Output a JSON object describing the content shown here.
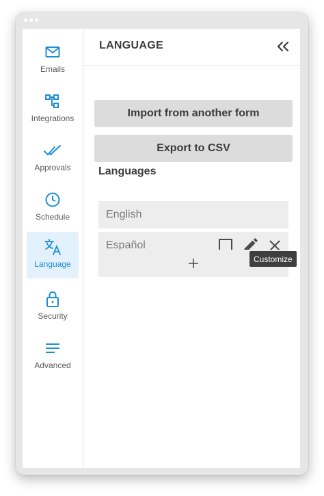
{
  "sidebar": {
    "items": [
      {
        "label": "Emails",
        "icon": "mail-icon",
        "active": false
      },
      {
        "label": "Integrations",
        "icon": "integrations-icon",
        "active": false
      },
      {
        "label": "Approvals",
        "icon": "double-check-icon",
        "active": false
      },
      {
        "label": "Schedule",
        "icon": "clock-icon",
        "active": false
      },
      {
        "label": "Language",
        "icon": "translate-icon",
        "active": true
      },
      {
        "label": "Security",
        "icon": "lock-icon",
        "active": false
      },
      {
        "label": "Advanced",
        "icon": "lines-icon",
        "active": false
      }
    ]
  },
  "header": {
    "title": "LANGUAGE",
    "collapse_icon": "double-chevron-left-icon"
  },
  "actions": {
    "import_label": "Import from another form",
    "export_label": "Export to CSV"
  },
  "languages": {
    "title": "Languages",
    "items": [
      {
        "name": "English"
      },
      {
        "name": "Español",
        "actions": [
          "checkbox-icon",
          "pencil-icon",
          "close-icon"
        ]
      }
    ],
    "add_icon": "plus-icon"
  },
  "tooltip": {
    "text": "Customize"
  },
  "colors": {
    "accent": "#1b8ed6",
    "active_bg": "#e2f1fb",
    "button_bg": "#dcdcdc",
    "row_bg": "#ededed",
    "tooltip_bg": "#3f3f3f"
  }
}
